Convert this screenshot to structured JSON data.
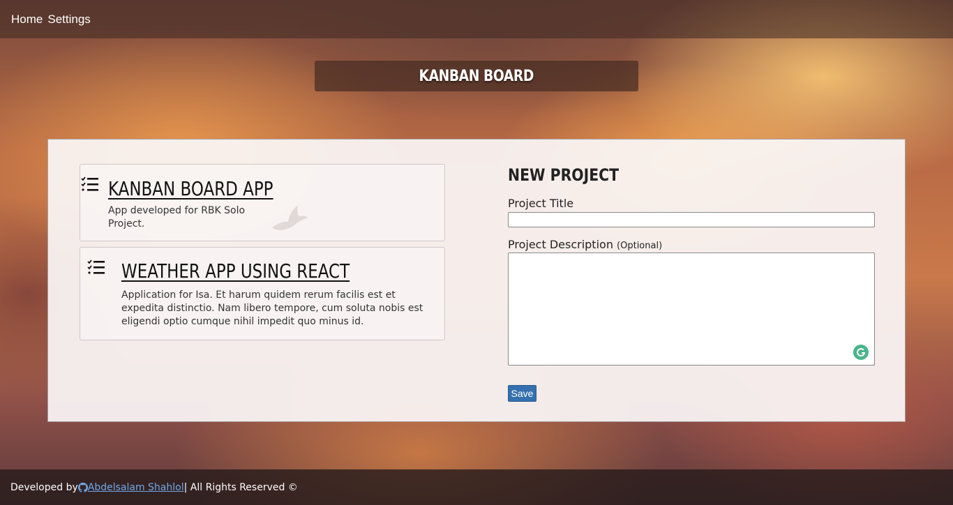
{
  "nav": {
    "items": [
      {
        "label": "Home"
      },
      {
        "label": "Settings"
      }
    ]
  },
  "header": {
    "title": "KANBAN BOARD"
  },
  "projects": [
    {
      "icon": "list-check-icon",
      "title": "KANBAN BOARD APP",
      "description": "App developed for RBK Solo Project."
    },
    {
      "icon": "list-check-icon",
      "title": "WEATHER APP USING REACT",
      "description": "Application for Isa. Et harum quidem rerum facilis est et expedita distinctio. Nam libero tempore, cum soluta nobis est eligendi optio cumque nihil impedit quo minus id."
    }
  ],
  "form": {
    "heading": "NEW PROJECT",
    "title_label": "Project Title",
    "title_value": "",
    "description_label": "Project Description",
    "description_optional": "(Optional)",
    "description_value": "",
    "save_label": "Save"
  },
  "footer": {
    "prefix": "Developed by ",
    "author": "Abdelsalam Shahlol",
    "suffix": " | All Rights Reserved ©"
  },
  "colors": {
    "save_button": "#3470ad",
    "link": "#6fa8e8",
    "grammarly": "#4ab48c"
  }
}
